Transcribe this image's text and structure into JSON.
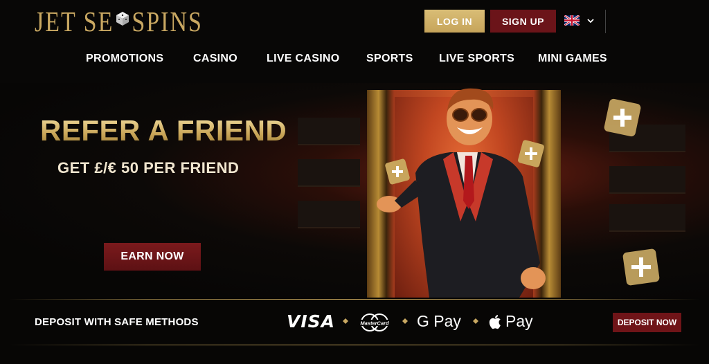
{
  "header": {
    "logo_text_left": "JET SE",
    "logo_text_right": "SPINS",
    "login_label": "LOG IN",
    "signup_label": "SIGN UP"
  },
  "nav": {
    "items": [
      "PROMOTIONS",
      "CASINO",
      "LIVE CASINO",
      "SPORTS",
      "LIVE SPORTS",
      "MINI GAMES"
    ]
  },
  "hero": {
    "title": "REFER A FRIEND",
    "subtitle": "GET £/€ 50 PER FRIEND",
    "cta_label": "EARN NOW"
  },
  "payments": {
    "label": "DEPOSIT WITH SAFE METHODS",
    "visa": "VISA",
    "mastercard": "MasterCard",
    "gpay": "G Pay",
    "applepay": "Pay",
    "deposit_label": "DEPOSIT NOW"
  },
  "colors": {
    "gold": "#c9a862",
    "login_bg": "#d1b26a",
    "signup_bg": "#6b1419",
    "cta_bg": "#6f1418"
  },
  "icons": [
    "uk-flag-icon",
    "chevron-down-icon",
    "dice-icon",
    "mastercard-icon",
    "apple-icon",
    "diamond-separator-icon"
  ]
}
